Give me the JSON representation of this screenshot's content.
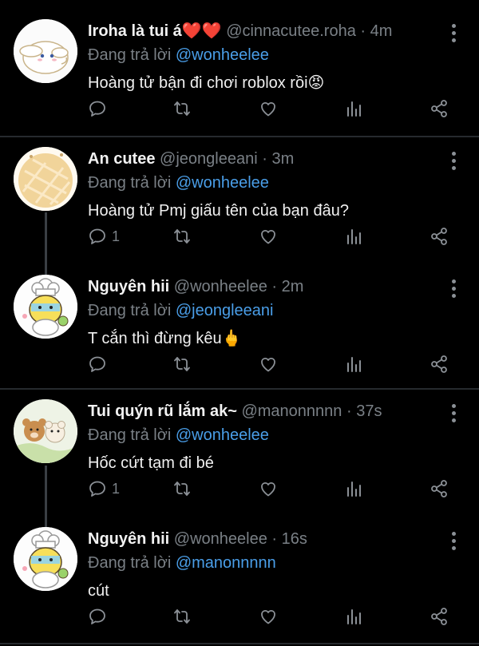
{
  "tweets": [
    {
      "name": "Iroha là tui á",
      "name_suffix": "❤️❤️",
      "handle": "@cinnacutee.roha",
      "time": "4m",
      "reply_prefix": "Đang trả lời",
      "reply_to": "@wonheelee",
      "text": "Hoàng tử bận đi chơi roblox rồi😡",
      "reply_count": "",
      "avatar": "cinnamoroll-avatar"
    },
    {
      "name": "An cutee",
      "handle": "@jeongleeani",
      "time": "3m",
      "reply_prefix": "Đang trả lời",
      "reply_to": "@wonheelee",
      "text": "Hoàng tử Pmj giấu tên của bạn đâu?",
      "reply_count": "1",
      "avatar": "melon-bread-avatar"
    },
    {
      "name": "Nguyên hii",
      "handle": "@wonheelee",
      "time": "2m",
      "reply_prefix": "Đang trả lời",
      "reply_to": "@jeongleeani",
      "text": "T cắn thì đừng kêu🖕",
      "reply_count": "",
      "avatar": "chef-bear-avatar"
    },
    {
      "name": "Tui quýn rũ lắm ak~",
      "handle": "@manonnnnn",
      "time": "37s",
      "reply_prefix": "Đang trả lời",
      "reply_to": "@wonheelee",
      "text": "Hốc cứt tạm đi bé",
      "reply_count": "1",
      "avatar": "bears-avatar"
    },
    {
      "name": "Nguyên hii",
      "handle": "@wonheelee",
      "time": "16s",
      "reply_prefix": "Đang trả lời",
      "reply_to": "@manonnnnn",
      "text": "cút",
      "reply_count": "",
      "avatar": "chef-bear-avatar"
    }
  ],
  "colors": {
    "mention": "#4a9ee8",
    "muted": "#7a8086",
    "background": "#000000"
  }
}
